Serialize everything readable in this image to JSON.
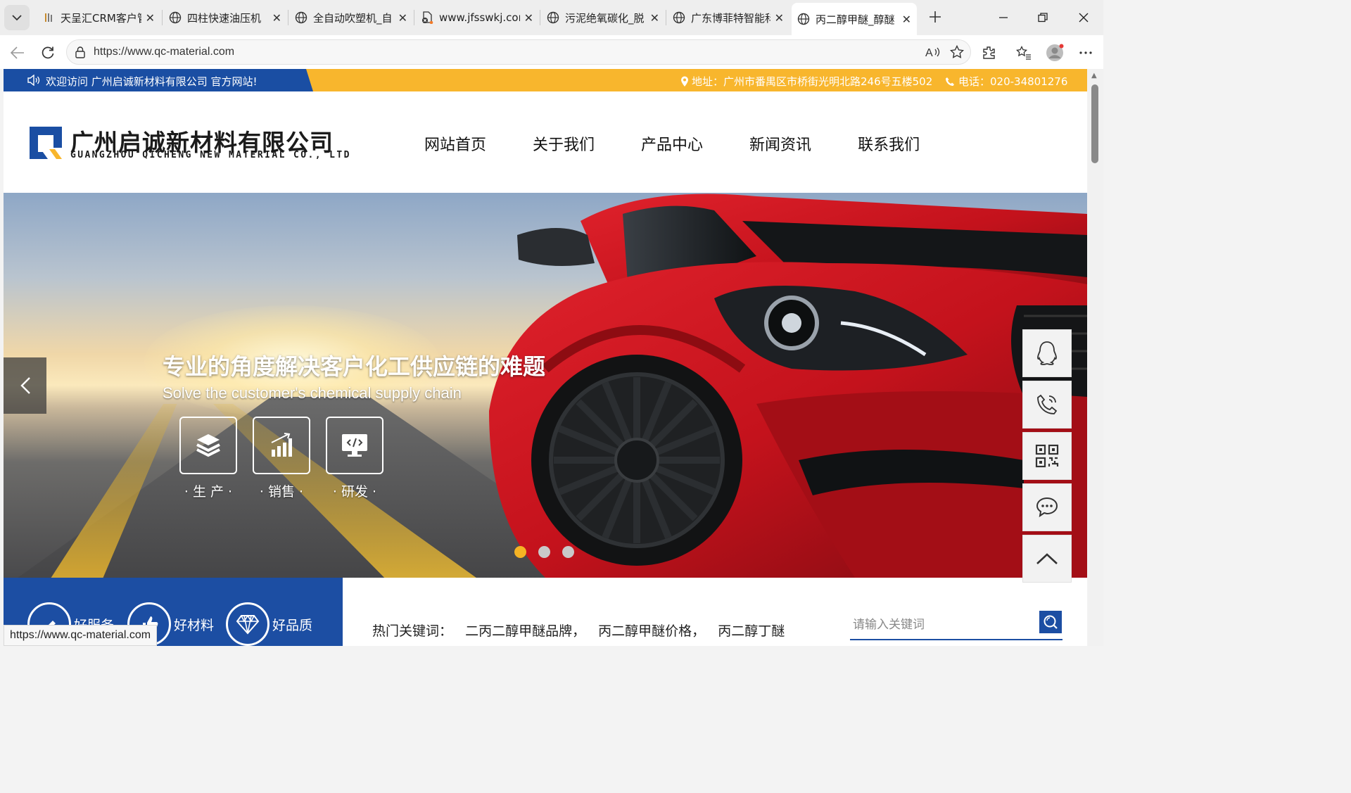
{
  "browser": {
    "tabs": [
      {
        "title": "天呈汇CRM客户管",
        "fav": "crm"
      },
      {
        "title": "四柱快速油压机",
        "fav": "globe"
      },
      {
        "title": "全自动吹塑机_自",
        "fav": "globe"
      },
      {
        "title": "www.jfsswkj.com",
        "fav": "doc"
      },
      {
        "title": "污泥绝氧碳化_脱",
        "fav": "globe"
      },
      {
        "title": "广东博菲特智能科",
        "fav": "globe"
      },
      {
        "title": "丙二醇甲醚_醇醚",
        "fav": "globe"
      }
    ],
    "url": "https://www.qc-material.com",
    "status_url": "https://www.qc-material.com"
  },
  "site": {
    "welcome": "欢迎访问 广州启诚新材料有限公司 官方网站!",
    "address": "地址：广州市番禺区市桥街光明北路246号五楼502",
    "phone": "电话：020-34801276",
    "logo_cn": "广州启诚新材料有限公司",
    "logo_en": "GUANGZHOU QICHENG NEW MATERIAL CO., LTD",
    "nav": [
      "网站首页",
      "关于我们",
      "产品中心",
      "新闻资讯",
      "联系我们"
    ],
    "banner": {
      "headline": "专业的角度解决客户化工供应链的难题",
      "subline": "Solve the customer's chemical supply chain",
      "features": [
        "· 生 产 ·",
        "· 销售 ·",
        "· 研发 ·"
      ],
      "slide_count": 3,
      "active_slide": 1
    },
    "perks": [
      "好服务",
      "好材料",
      "好品质"
    ],
    "hot_label": "热门关键词：",
    "hot_keywords": [
      "二丙二醇甲醚品牌，",
      "丙二醇甲醚价格，",
      "丙二醇丁醚"
    ],
    "search_placeholder": "请输入关键词"
  },
  "colors": {
    "brand_blue": "#1a4ea3",
    "accent_yellow": "#f8b62d"
  }
}
